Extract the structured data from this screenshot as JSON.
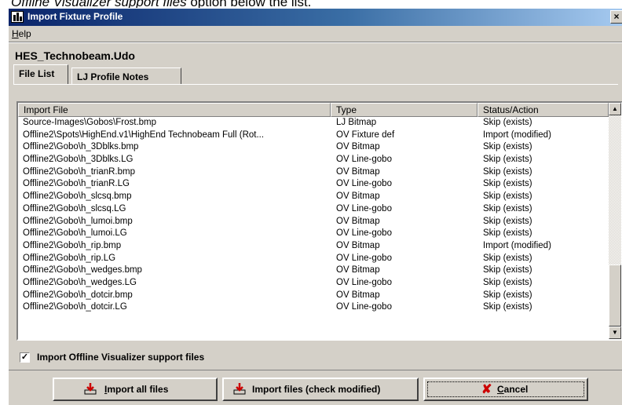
{
  "caption": {
    "italic_text": "Offline Visualizer support files",
    "rest_text": " option below the list."
  },
  "window": {
    "title": "Import Fixture Profile",
    "close_glyph": "×"
  },
  "menu": {
    "help_label": "Help"
  },
  "profile_name": "HES_Technobeam.Udo",
  "tabs": [
    {
      "label": "File List"
    },
    {
      "label": "LJ Profile Notes"
    }
  ],
  "list": {
    "columns": [
      "Import File",
      "Type",
      "Status/Action"
    ],
    "rows": [
      {
        "file": "Source-Images\\Gobos\\Frost.bmp",
        "type": "LJ Bitmap",
        "status": "Skip (exists)"
      },
      {
        "file": "Offline2\\Spots\\HighEnd.v1\\HighEnd Technobeam Full (Rot...",
        "type": "OV Fixture def",
        "status": "Import (modified)"
      },
      {
        "file": "Offline2\\Gobo\\h_3Dblks.bmp",
        "type": "OV Bitmap",
        "status": "Skip (exists)"
      },
      {
        "file": "Offline2\\Gobo\\h_3Dblks.LG",
        "type": "OV Line-gobo",
        "status": "Skip (exists)"
      },
      {
        "file": "Offline2\\Gobo\\h_trianR.bmp",
        "type": "OV Bitmap",
        "status": "Skip (exists)"
      },
      {
        "file": "Offline2\\Gobo\\h_trianR.LG",
        "type": "OV Line-gobo",
        "status": "Skip (exists)"
      },
      {
        "file": "Offline2\\Gobo\\h_slcsq.bmp",
        "type": "OV Bitmap",
        "status": "Skip (exists)"
      },
      {
        "file": "Offline2\\Gobo\\h_slcsq.LG",
        "type": "OV Line-gobo",
        "status": "Skip (exists)"
      },
      {
        "file": "Offline2\\Gobo\\h_lumoi.bmp",
        "type": "OV Bitmap",
        "status": "Skip (exists)"
      },
      {
        "file": "Offline2\\Gobo\\h_lumoi.LG",
        "type": "OV Line-gobo",
        "status": "Skip (exists)"
      },
      {
        "file": "Offline2\\Gobo\\h_rip.bmp",
        "type": "OV Bitmap",
        "status": "Import (modified)"
      },
      {
        "file": "Offline2\\Gobo\\h_rip.LG",
        "type": "OV Line-gobo",
        "status": "Skip (exists)"
      },
      {
        "file": "Offline2\\Gobo\\h_wedges.bmp",
        "type": "OV Bitmap",
        "status": "Skip (exists)"
      },
      {
        "file": "Offline2\\Gobo\\h_wedges.LG",
        "type": "OV Line-gobo",
        "status": "Skip (exists)"
      },
      {
        "file": "Offline2\\Gobo\\h_dotcir.bmp",
        "type": "OV Bitmap",
        "status": "Skip (exists)"
      },
      {
        "file": "Offline2\\Gobo\\h_dotcir.LG",
        "type": "OV Line-gobo",
        "status": "Skip (exists)"
      }
    ]
  },
  "import_support_files": {
    "checked": true,
    "check_glyph": "✓",
    "label": "Import Offline Visualizer support files"
  },
  "buttons": {
    "import_all": "Import all files",
    "import_modified": "Import files (check modified)",
    "cancel": "Cancel"
  },
  "icons": {
    "app": "lightjockey-app-icon",
    "import": "import-tray-icon",
    "cancel": "red-x-icon"
  },
  "colors": {
    "title_start": "#0a246a",
    "title_end": "#a6caf0",
    "face": "#d4d0c8",
    "cancel_x": "#cc0000",
    "import_icon": "#cc0000"
  }
}
